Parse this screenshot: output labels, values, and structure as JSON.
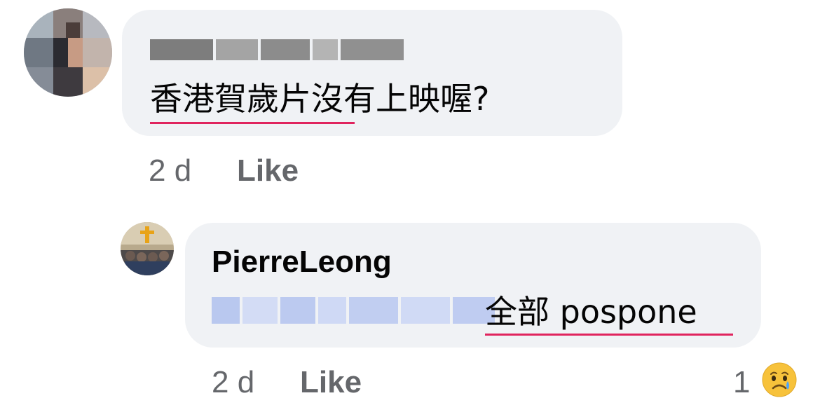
{
  "comments": [
    {
      "author_name_blurred": true,
      "text": "香港賀歲片沒有上映喔?",
      "time": "2 d",
      "like_label": "Like"
    },
    {
      "author_name": "PierreLeong",
      "mention_blurred": true,
      "text": "全部 pospone",
      "time": "2 d",
      "like_label": "Like",
      "reaction_count": "1",
      "reaction_icon": "crying-face-icon"
    }
  ],
  "colors": {
    "bubble": "#f0f2f5",
    "meta_text": "#65676b",
    "spell_underline": "#e0245e",
    "mention_blur": "#c3d0f2"
  }
}
